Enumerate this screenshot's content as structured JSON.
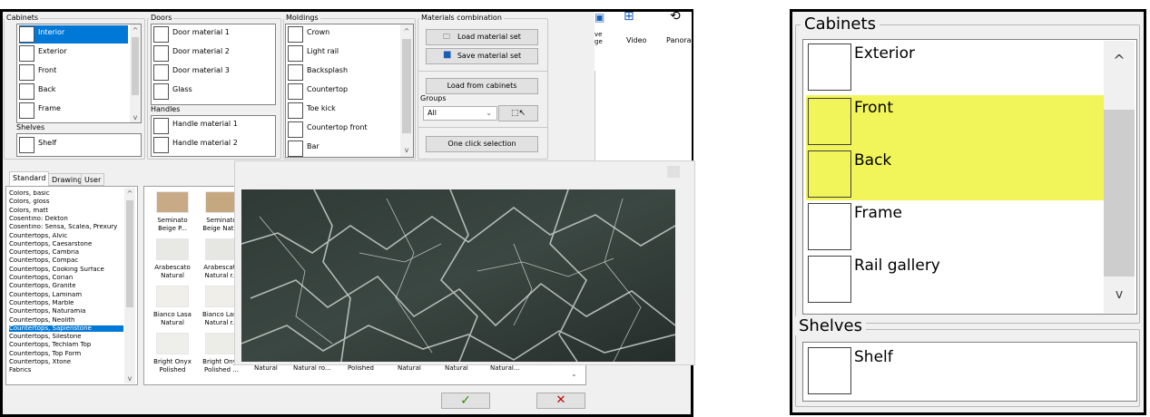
{
  "cabinets": {
    "label": "Cabinets",
    "items": [
      "Interior",
      "Exterior",
      "Front",
      "Back",
      "Frame"
    ],
    "selected": "Interior"
  },
  "shelves": {
    "label": "Shelves",
    "items": [
      "Shelf"
    ]
  },
  "doors": {
    "label": "Doors",
    "items": [
      "Door material 1",
      "Door material 2",
      "Door material 3",
      "Glass"
    ]
  },
  "handles": {
    "label": "Handles",
    "items": [
      "Handle material 1",
      "Handle material 2"
    ]
  },
  "moldings": {
    "label": "Moldings",
    "items": [
      "Crown",
      "Light rail",
      "Backsplash",
      "Countertop",
      "Toe kick",
      "Countertop front",
      "Bar"
    ]
  },
  "materials_combination": {
    "label": "Materials combination",
    "load_set": "Load material set",
    "save_set": "Save material set",
    "load_cabinets": "Load from cabinets",
    "groups_label": "Groups",
    "groups_value": "All",
    "one_click": "One click selection"
  },
  "ribbon": {
    "partial_left": "ve\nge",
    "video": "Video",
    "panorama": "Panoran"
  },
  "tabs": [
    "Standard",
    "Drawing",
    "User"
  ],
  "categories": [
    "Colors, basic",
    "Colors, gloss",
    "Colors, matt",
    "Cosentino: Dekton",
    "Cosentino: Sensa, Scalea, Prexury",
    "Countertops, Alvic",
    "Countertops, Caesarstone",
    "Countertops, Cambria",
    "Countertops, Compac",
    "Countertops, Cooking Surface",
    "Countertops, Corian",
    "Countertops, Granite",
    "Countertops, Laminam",
    "Countertops, Marble",
    "Countertops, Naturamia",
    "Countertops, Neolith",
    "Countertops, Sapienstone",
    "Countertops, Silestone",
    "Countertops, Techlam Top",
    "Countertops, Top Form",
    "Countertops, Xtone",
    "Fabrics"
  ],
  "selected_category": "Countertops, Sapienstone",
  "materials": [
    {
      "line1": "Seminato",
      "line2": "Beige P...",
      "color": "#c8aa86"
    },
    {
      "line1": "Seminato",
      "line2": "Beige Natur",
      "color": "#c6a880"
    },
    {
      "line1": "Arabescato",
      "line2": "Natural",
      "color": "#e8e8e4"
    },
    {
      "line1": "Arabescato",
      "line2": "Natural r...",
      "color": "#e6e6e2"
    },
    {
      "line1": "Bianco Lasa",
      "line2": "Natural",
      "color": "#f0efea"
    },
    {
      "line1": "Bianco Lasa",
      "line2": "Natural r...",
      "color": "#efeee9"
    },
    {
      "line1": "Bright Onyx",
      "line2": "Polished",
      "color": "#eeeeea"
    },
    {
      "line1": "Bright Onyx",
      "line2": "Polished ...",
      "color": "#edede8"
    }
  ],
  "row_labels": [
    "Natural",
    "Natural ro...",
    "Polished",
    "Natural",
    "Natural",
    "Natural..."
  ],
  "ok_symbol": "✓",
  "cancel_symbol": "✕",
  "zoom": {
    "cabinets_label": "Cabinets",
    "items": [
      {
        "label": "Exterior",
        "highlight": false
      },
      {
        "label": "Front",
        "highlight": true
      },
      {
        "label": "Back",
        "highlight": true
      },
      {
        "label": "Frame",
        "highlight": false
      },
      {
        "label": "Rail gallery",
        "highlight": false
      }
    ],
    "shelves_label": "Shelves",
    "shelf": "Shelf",
    "highlight_color": "#f2f55a"
  }
}
